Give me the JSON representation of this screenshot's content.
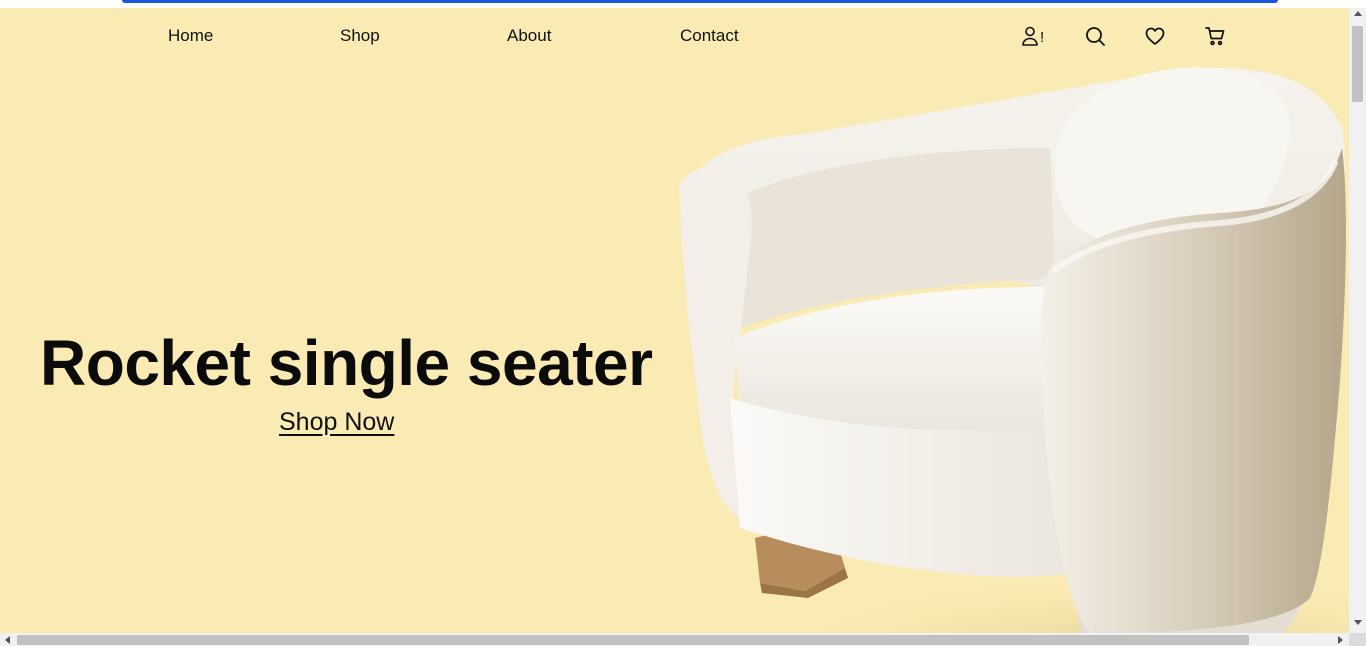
{
  "nav": {
    "links": [
      {
        "label": "Home"
      },
      {
        "label": "Shop"
      },
      {
        "label": "About"
      },
      {
        "label": "Contact"
      }
    ],
    "icons": [
      "user-alert-icon",
      "search-icon",
      "heart-icon",
      "cart-icon"
    ],
    "user_alert_mark": "!"
  },
  "hero": {
    "title": "Rocket single seater",
    "cta_label": "Shop Now",
    "background_color": "#f9ebb3",
    "product_image": "white-armchair"
  },
  "colors": {
    "focus_bar": "#1a56db",
    "text": "#111111"
  }
}
